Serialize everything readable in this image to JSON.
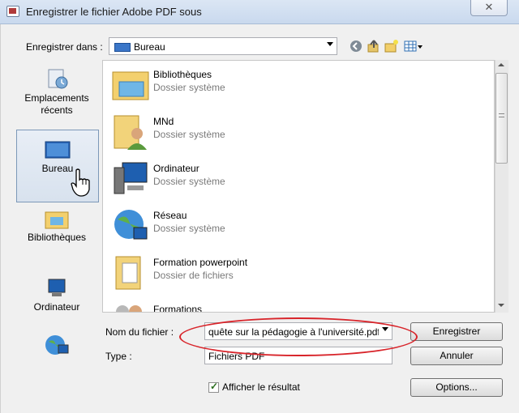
{
  "window": {
    "title": "Enregistrer le fichier Adobe PDF sous",
    "close_glyph": "✕"
  },
  "toolbar": {
    "save_in_label": "Enregistrer dans :",
    "save_in_value": "Bureau",
    "icons": [
      "back-icon",
      "up-folder-icon",
      "new-folder-icon",
      "views-menu-icon"
    ]
  },
  "places": [
    {
      "label": "Emplacements récents",
      "icon": "recent-places-icon"
    },
    {
      "label": "Bureau",
      "icon": "desktop-icon",
      "selected": true
    },
    {
      "label": "Bibliothèques",
      "icon": "libraries-icon"
    },
    {
      "label": "Ordinateur",
      "icon": "computer-icon"
    },
    {
      "label": "",
      "icon": "network-icon"
    }
  ],
  "files": [
    {
      "name": "Bibliothèques",
      "type": "Dossier système",
      "icon": "libraries-folder-icon"
    },
    {
      "name": "MNd",
      "type": "Dossier système",
      "icon": "user-folder-icon"
    },
    {
      "name": "Ordinateur",
      "type": "Dossier système",
      "icon": "computer-icon"
    },
    {
      "name": "Réseau",
      "type": "Dossier système",
      "icon": "network-globe-icon"
    },
    {
      "name": "Formation powerpoint",
      "type": "Dossier de fichiers",
      "icon": "folder-icon"
    },
    {
      "name": "Formations",
      "type": "",
      "icon": "folder-people-icon"
    }
  ],
  "form": {
    "filename_label": "Nom du fichier :",
    "filename_value": "quête sur la pédagogie à l'université.pdf",
    "type_label": "Type :",
    "type_value": "Fichiers PDF",
    "show_result_label": "Afficher le résultat",
    "show_result_checked": true
  },
  "buttons": {
    "save": "Enregistrer",
    "cancel": "Annuler",
    "options": "Options..."
  },
  "colors": {
    "annotation_oval": "#d8242a",
    "selection_border": "#7c98b8"
  },
  "cursor": "hand-pointer-icon"
}
